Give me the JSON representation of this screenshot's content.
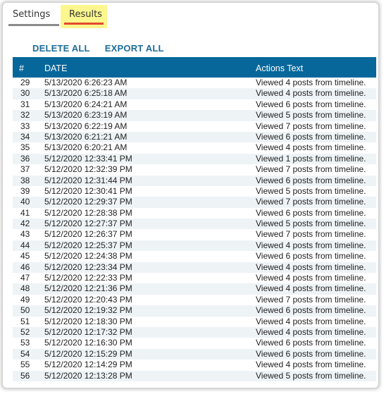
{
  "tabs": [
    {
      "label": "Settings"
    },
    {
      "label": "Results"
    }
  ],
  "actions": {
    "delete_all": "DELETE ALL",
    "export_all": "EXPORT ALL"
  },
  "table": {
    "columns": [
      "#",
      "DATE",
      "Actions Text"
    ],
    "rows": [
      {
        "num": "29",
        "date": "5/13/2020 6:26:23 AM",
        "text": "Viewed 4 posts from timeline."
      },
      {
        "num": "30",
        "date": "5/13/2020 6:25:18 AM",
        "text": "Viewed 4 posts from timeline."
      },
      {
        "num": "31",
        "date": "5/13/2020 6:24:21 AM",
        "text": "Viewed 6 posts from timeline."
      },
      {
        "num": "32",
        "date": "5/13/2020 6:23:19 AM",
        "text": "Viewed 5 posts from timeline."
      },
      {
        "num": "33",
        "date": "5/13/2020 6:22:19 AM",
        "text": "Viewed 7 posts from timeline."
      },
      {
        "num": "34",
        "date": "5/13/2020 6:21:21 AM",
        "text": "Viewed 6 posts from timeline."
      },
      {
        "num": "35",
        "date": "5/13/2020 6:20:21 AM",
        "text": "Viewed 4 posts from timeline."
      },
      {
        "num": "36",
        "date": "5/12/2020 12:33:41 PM",
        "text": "Viewed 1 posts from timeline."
      },
      {
        "num": "37",
        "date": "5/12/2020 12:32:39 PM",
        "text": "Viewed 7 posts from timeline."
      },
      {
        "num": "38",
        "date": "5/12/2020 12:31:44 PM",
        "text": "Viewed 6 posts from timeline."
      },
      {
        "num": "39",
        "date": "5/12/2020 12:30:41 PM",
        "text": "Viewed 5 posts from timeline."
      },
      {
        "num": "40",
        "date": "5/12/2020 12:29:37 PM",
        "text": "Viewed 7 posts from timeline."
      },
      {
        "num": "41",
        "date": "5/12/2020 12:28:38 PM",
        "text": "Viewed 6 posts from timeline."
      },
      {
        "num": "42",
        "date": "5/12/2020 12:27:37 PM",
        "text": "Viewed 5 posts from timeline."
      },
      {
        "num": "43",
        "date": "5/12/2020 12:26:37 PM",
        "text": "Viewed 7 posts from timeline."
      },
      {
        "num": "44",
        "date": "5/12/2020 12:25:37 PM",
        "text": "Viewed 4 posts from timeline."
      },
      {
        "num": "45",
        "date": "5/12/2020 12:24:38 PM",
        "text": "Viewed 6 posts from timeline."
      },
      {
        "num": "46",
        "date": "5/12/2020 12:23:34 PM",
        "text": "Viewed 4 posts from timeline."
      },
      {
        "num": "47",
        "date": "5/12/2020 12:22:33 PM",
        "text": "Viewed 4 posts from timeline."
      },
      {
        "num": "48",
        "date": "5/12/2020 12:21:36 PM",
        "text": "Viewed 4 posts from timeline."
      },
      {
        "num": "49",
        "date": "5/12/2020 12:20:43 PM",
        "text": "Viewed 7 posts from timeline."
      },
      {
        "num": "50",
        "date": "5/12/2020 12:19:32 PM",
        "text": "Viewed 6 posts from timeline."
      },
      {
        "num": "51",
        "date": "5/12/2020 12:18:30 PM",
        "text": "Viewed 4 posts from timeline."
      },
      {
        "num": "52",
        "date": "5/12/2020 12:17:32 PM",
        "text": "Viewed 4 posts from timeline."
      },
      {
        "num": "53",
        "date": "5/12/2020 12:16:30 PM",
        "text": "Viewed 6 posts from timeline."
      },
      {
        "num": "54",
        "date": "5/12/2020 12:15:29 PM",
        "text": "Viewed 6 posts from timeline."
      },
      {
        "num": "55",
        "date": "5/12/2020 12:14:29 PM",
        "text": "Viewed 4 posts from timeline."
      },
      {
        "num": "56",
        "date": "5/12/2020 12:13:28 PM",
        "text": "Viewed 5 posts from timeline."
      }
    ]
  },
  "colors": {
    "header_bg": "#07679a",
    "link": "#1d6c97",
    "active_tab_bg": "#fbf68d",
    "active_tab_underline": "#e2492d",
    "inactive_tab_underline": "#8a8a8a",
    "alt_row_bg": "#eef3f6"
  }
}
